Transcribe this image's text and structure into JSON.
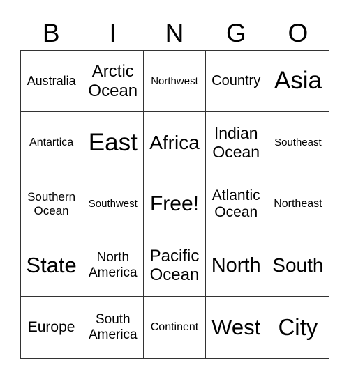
{
  "header": [
    "B",
    "I",
    "N",
    "G",
    "O"
  ],
  "cells": [
    {
      "text": "Australia",
      "size": 18
    },
    {
      "text": "Arctic Ocean",
      "size": 24
    },
    {
      "text": "Northwest",
      "size": 15
    },
    {
      "text": "Country",
      "size": 20
    },
    {
      "text": "Asia",
      "size": 35
    },
    {
      "text": "Antartica",
      "size": 16
    },
    {
      "text": "East",
      "size": 35
    },
    {
      "text": "Africa",
      "size": 28
    },
    {
      "text": "Indian Ocean",
      "size": 23
    },
    {
      "text": "Southeast",
      "size": 15
    },
    {
      "text": "Southern Ocean",
      "size": 17
    },
    {
      "text": "Southwest",
      "size": 15
    },
    {
      "text": "Free!",
      "size": 30
    },
    {
      "text": "Atlantic Ocean",
      "size": 21
    },
    {
      "text": "Northeast",
      "size": 16
    },
    {
      "text": "State",
      "size": 31
    },
    {
      "text": "North America",
      "size": 19
    },
    {
      "text": "Pacific Ocean",
      "size": 24
    },
    {
      "text": "North",
      "size": 29
    },
    {
      "text": "South",
      "size": 28
    },
    {
      "text": "Europe",
      "size": 21
    },
    {
      "text": "South America",
      "size": 19
    },
    {
      "text": "Continent",
      "size": 16
    },
    {
      "text": "West",
      "size": 31
    },
    {
      "text": "City",
      "size": 33
    }
  ]
}
